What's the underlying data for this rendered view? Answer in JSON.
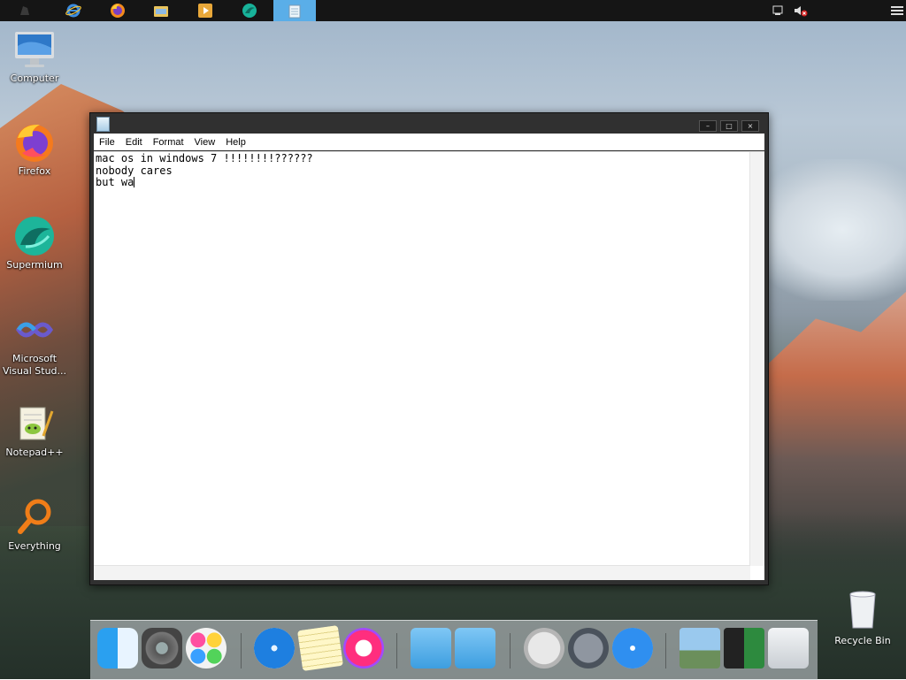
{
  "taskbar": {
    "items": [
      {
        "name": "system-menu-icon",
        "color": "#2a2a2a"
      },
      {
        "name": "internet-explorer-icon",
        "color": "#2f7fd8"
      },
      {
        "name": "firefox-icon",
        "color": "#e96a1b"
      },
      {
        "name": "file-explorer-icon",
        "color": "#e5c25a"
      },
      {
        "name": "media-player-icon",
        "color": "#e6a52b"
      },
      {
        "name": "supermium-icon",
        "color": "#1aa98f"
      },
      {
        "name": "notepad-icon",
        "color": "#dfeef8"
      }
    ],
    "active_index": 6
  },
  "desktop_icons": [
    {
      "label": "Computer",
      "icon": "computer-icon"
    },
    {
      "label": "Firefox",
      "icon": "firefox-icon"
    },
    {
      "label": "Supermium",
      "icon": "supermium-icon"
    },
    {
      "label": "Microsoft Visual Stud...",
      "icon": "visual-studio-icon"
    },
    {
      "label": "Notepad++",
      "icon": "notepadpp-icon"
    },
    {
      "label": "Everything",
      "icon": "everything-search-icon"
    }
  ],
  "notepad": {
    "menu": [
      "File",
      "Edit",
      "Format",
      "View",
      "Help"
    ],
    "lines": [
      "mac os in windows 7 !!!!!!!!??????",
      "nobody cares",
      "but wa"
    ],
    "controls": {
      "minimize": "–",
      "maximize": "□",
      "close": "×"
    }
  },
  "recycle_bin": {
    "label": "Recycle Bin"
  },
  "colors": {
    "active_task": "#5aaee8",
    "dock": "#d2d7dc"
  }
}
